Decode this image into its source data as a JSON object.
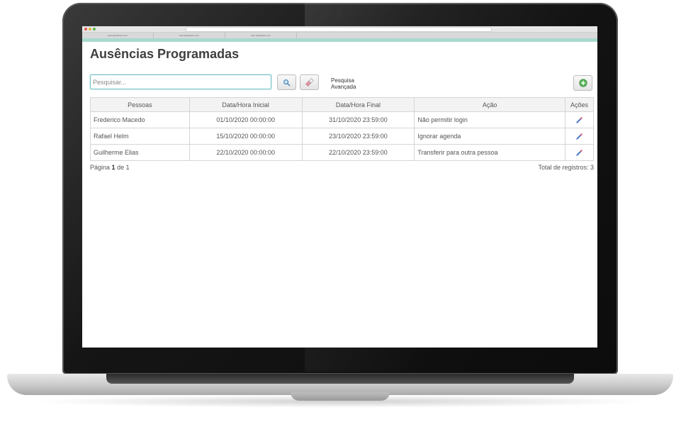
{
  "browser": {
    "tabs": [
      "www.globalteam.com",
      "www.globalteam.com",
      "www.globalteam.com"
    ]
  },
  "page": {
    "title": "Ausências Programadas"
  },
  "toolbar": {
    "search_placeholder": "Pesquisar...",
    "advanced_search_line1": "Pesquisa",
    "advanced_search_line2": "Avançada",
    "search_icon": "magnifier-icon",
    "clear_icon": "eraser-icon",
    "add_icon": "plus-circle-icon",
    "accent_color": "#74c0c6"
  },
  "table": {
    "columns": [
      "Pessoas",
      "Data/Hora Inicial",
      "Data/Hora Final",
      "Ação",
      "Ações"
    ],
    "rows": [
      {
        "pessoa": "Frederico Macedo",
        "inicio": "01/10/2020 00:00:00",
        "fim": "31/10/2020 23:59:00",
        "acao": "Não permitir login"
      },
      {
        "pessoa": "Rafael Helm",
        "inicio": "15/10/2020 00:00:00",
        "fim": "23/10/2020 23:59:00",
        "acao": "Ignorar agenda"
      },
      {
        "pessoa": "Guilherme Elias",
        "inicio": "22/10/2020 00:00:00",
        "fim": "22/10/2020 23:59:00",
        "acao": "Transferir para outra pessoa"
      }
    ],
    "row_action_icon": "edit-pencil-icon"
  },
  "footer": {
    "page_prefix": "Página",
    "page_current": "1",
    "page_middle": "de",
    "page_total": "1",
    "total_records": "Total de registros: 3"
  }
}
